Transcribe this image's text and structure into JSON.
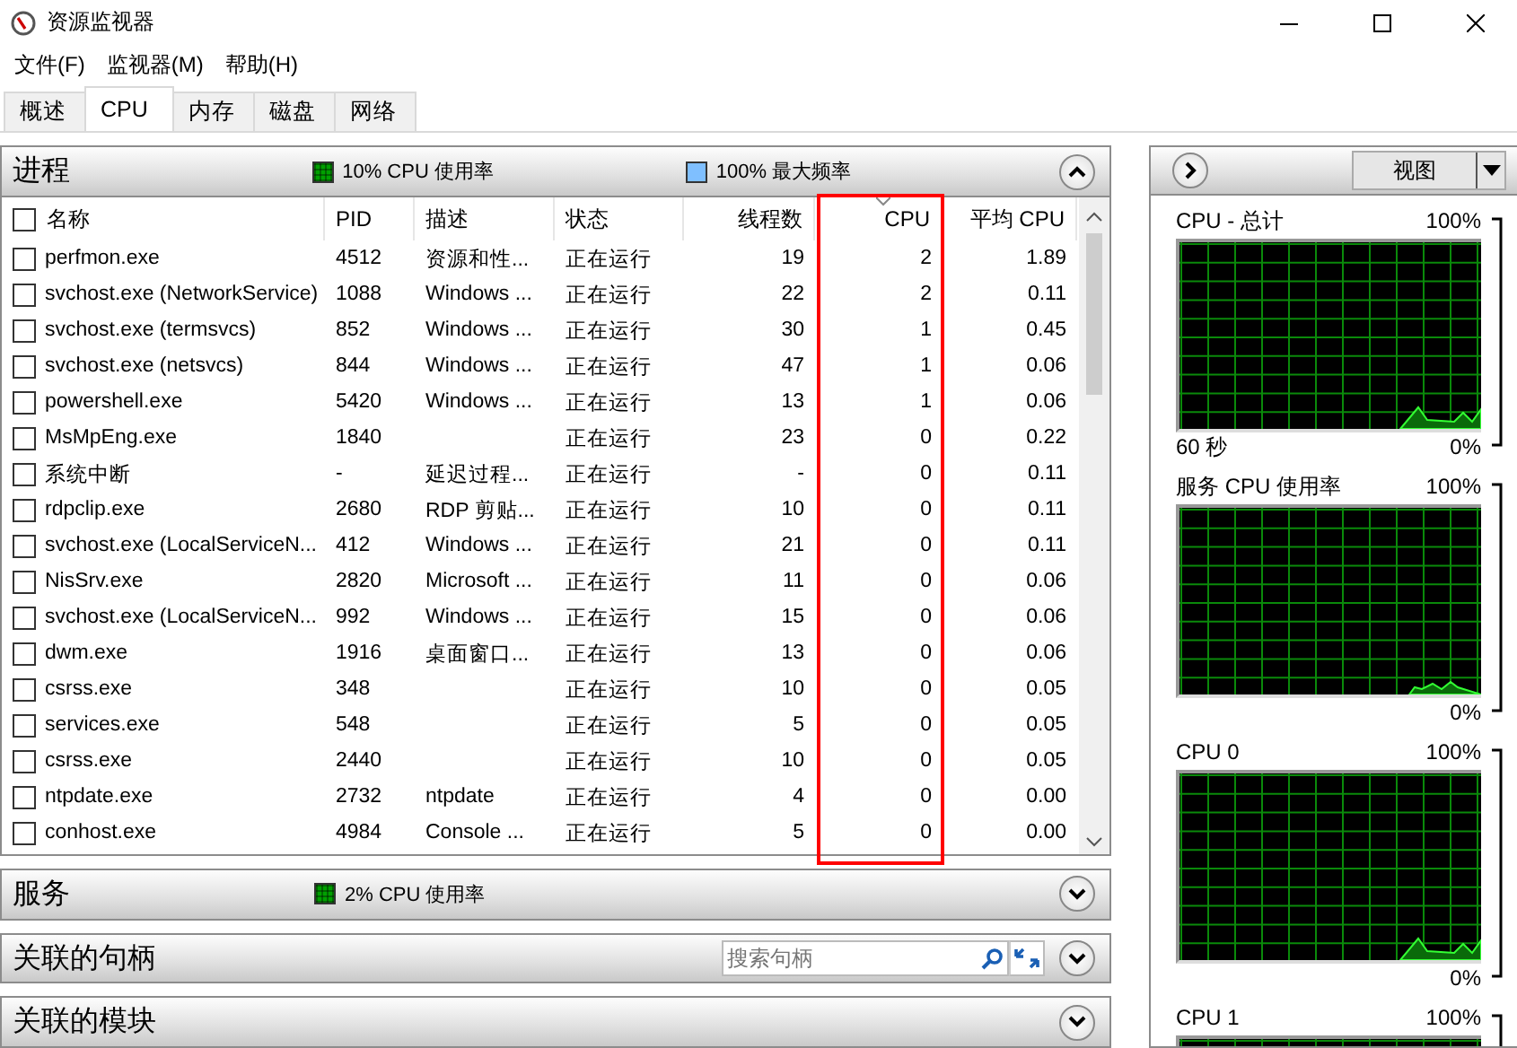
{
  "window": {
    "title": "资源监视器"
  },
  "menu": [
    {
      "label": "文件(F)"
    },
    {
      "label": "监视器(M)"
    },
    {
      "label": "帮助(H)"
    }
  ],
  "tabs": [
    {
      "label": "概述",
      "selected": false
    },
    {
      "label": "CPU",
      "selected": true
    },
    {
      "label": "内存",
      "selected": false
    },
    {
      "label": "磁盘",
      "selected": false
    },
    {
      "label": "网络",
      "selected": false
    }
  ],
  "processes": {
    "title": "进程",
    "expanded": true,
    "stats": [
      {
        "text": "10% CPU 使用率",
        "color": "#00a000"
      },
      {
        "text": "100% 最大频率",
        "color": "#7fbfff"
      }
    ],
    "select_all": {
      "checked": false
    },
    "columns": [
      {
        "label": "名称",
        "sorted": false,
        "highlighted": false
      },
      {
        "label": "PID",
        "sorted": false,
        "highlighted": false
      },
      {
        "label": "描述",
        "sorted": false,
        "highlighted": false
      },
      {
        "label": "状态",
        "sorted": false,
        "highlighted": false
      },
      {
        "label": "线程数",
        "sorted": false,
        "highlighted": false
      },
      {
        "label": "CPU",
        "sorted": true,
        "highlighted": true
      },
      {
        "label": "平均 CPU",
        "sorted": false,
        "highlighted": false
      }
    ],
    "rows": [
      {
        "checked": false,
        "cells": [
          "perfmon.exe",
          "4512",
          "资源和性...",
          "正在运行",
          "19",
          "2",
          "1.89"
        ]
      },
      {
        "checked": false,
        "cells": [
          "svchost.exe (NetworkService)",
          "1088",
          "Windows ...",
          "正在运行",
          "22",
          "2",
          "0.11"
        ]
      },
      {
        "checked": false,
        "cells": [
          "svchost.exe (termsvcs)",
          "852",
          "Windows ...",
          "正在运行",
          "30",
          "1",
          "0.45"
        ]
      },
      {
        "checked": false,
        "cells": [
          "svchost.exe (netsvcs)",
          "844",
          "Windows ...",
          "正在运行",
          "47",
          "1",
          "0.06"
        ]
      },
      {
        "checked": false,
        "cells": [
          "powershell.exe",
          "5420",
          "Windows ...",
          "正在运行",
          "13",
          "1",
          "0.06"
        ]
      },
      {
        "checked": false,
        "cells": [
          "MsMpEng.exe",
          "1840",
          "",
          "正在运行",
          "23",
          "0",
          "0.22"
        ]
      },
      {
        "checked": false,
        "cells": [
          "系统中断",
          "-",
          "延迟过程...",
          "正在运行",
          "-",
          "0",
          "0.11"
        ]
      },
      {
        "checked": false,
        "cells": [
          "rdpclip.exe",
          "2680",
          "RDP 剪贴...",
          "正在运行",
          "10",
          "0",
          "0.11"
        ]
      },
      {
        "checked": false,
        "cells": [
          "svchost.exe (LocalServiceN...",
          "412",
          "Windows ...",
          "正在运行",
          "21",
          "0",
          "0.11"
        ]
      },
      {
        "checked": false,
        "cells": [
          "NisSrv.exe",
          "2820",
          "Microsoft ...",
          "正在运行",
          "11",
          "0",
          "0.06"
        ]
      },
      {
        "checked": false,
        "cells": [
          "svchost.exe (LocalServiceN...",
          "992",
          "Windows ...",
          "正在运行",
          "15",
          "0",
          "0.06"
        ]
      },
      {
        "checked": false,
        "cells": [
          "dwm.exe",
          "1916",
          "桌面窗口...",
          "正在运行",
          "13",
          "0",
          "0.06"
        ]
      },
      {
        "checked": false,
        "cells": [
          "csrss.exe",
          "348",
          "",
          "正在运行",
          "10",
          "0",
          "0.05"
        ]
      },
      {
        "checked": false,
        "cells": [
          "services.exe",
          "548",
          "",
          "正在运行",
          "5",
          "0",
          "0.05"
        ]
      },
      {
        "checked": false,
        "cells": [
          "csrss.exe",
          "2440",
          "",
          "正在运行",
          "10",
          "0",
          "0.05"
        ]
      },
      {
        "checked": false,
        "cells": [
          "ntpdate.exe",
          "2732",
          "ntpdate",
          "正在运行",
          "4",
          "0",
          "0.00"
        ]
      },
      {
        "checked": false,
        "cells": [
          "conhost.exe",
          "4984",
          "Console ...",
          "正在运行",
          "5",
          "0",
          "0.00"
        ]
      }
    ]
  },
  "sections": [
    {
      "title": "服务",
      "expanded": false,
      "stats": [
        {
          "text": "2% CPU 使用率",
          "color": "#00a000"
        }
      ]
    },
    {
      "title": "关联的句柄",
      "expanded": false,
      "search": {
        "placeholder": "搜索句柄"
      }
    },
    {
      "title": "关联的模块",
      "expanded": false
    }
  ],
  "side_panel": {
    "view_button": "视图",
    "graphs": [
      {
        "title": "CPU - 总计",
        "max": "100%",
        "time": "60 秒",
        "min": "0%"
      },
      {
        "title": "服务 CPU 使用率",
        "max": "100%",
        "min": "0%"
      },
      {
        "title": "CPU 0",
        "max": "100%",
        "min": "0%"
      },
      {
        "title": "CPU 1",
        "max": "100%"
      }
    ]
  }
}
